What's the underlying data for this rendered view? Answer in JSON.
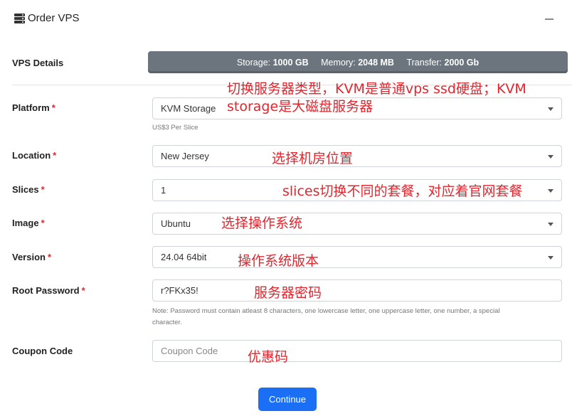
{
  "header": {
    "title": "Order VPS"
  },
  "details": {
    "label": "VPS Details",
    "storage_label": "Storage:",
    "storage_value": "1000 GB",
    "memory_label": "Memory:",
    "memory_value": "2048 MB",
    "transfer_label": "Transfer:",
    "transfer_value": "2000 Gb"
  },
  "form": {
    "required_mark": "*",
    "platform": {
      "label": "Platform",
      "value": "KVM Storage",
      "help": "US$3 Per Slice"
    },
    "location": {
      "label": "Location",
      "value": "New Jersey"
    },
    "slices": {
      "label": "Slices",
      "value": "1"
    },
    "image": {
      "label": "Image",
      "value": "Ubuntu"
    },
    "version": {
      "label": "Version",
      "value": "24.04 64bit"
    },
    "root_password": {
      "label": "Root Password",
      "value": "r?FKx35!",
      "help_line1": "Note: Password must contain atleast 8 characters, one lowercase letter, one uppercase letter, one number, a special",
      "help_line2": "character."
    },
    "coupon": {
      "label": "Coupon Code",
      "placeholder": "Coupon Code"
    }
  },
  "annotations": {
    "platform_line1": "切换服务器类型，KVM是普通vps ssd硬盘；KVM",
    "platform_line2": "storage是大磁盘服务器",
    "location": "选择机房位置",
    "slices": "slices切换不同的套餐，对应着官网套餐",
    "image": "选择操作系统",
    "version": "操作系统版本",
    "password": "服务器密码",
    "coupon": "优惠码"
  },
  "continue_label": "Continue",
  "colors": {
    "accent": "#1a6ff5",
    "required": "#e0262e",
    "details_bg": "#6c757d",
    "annotation": "#e0262e"
  }
}
